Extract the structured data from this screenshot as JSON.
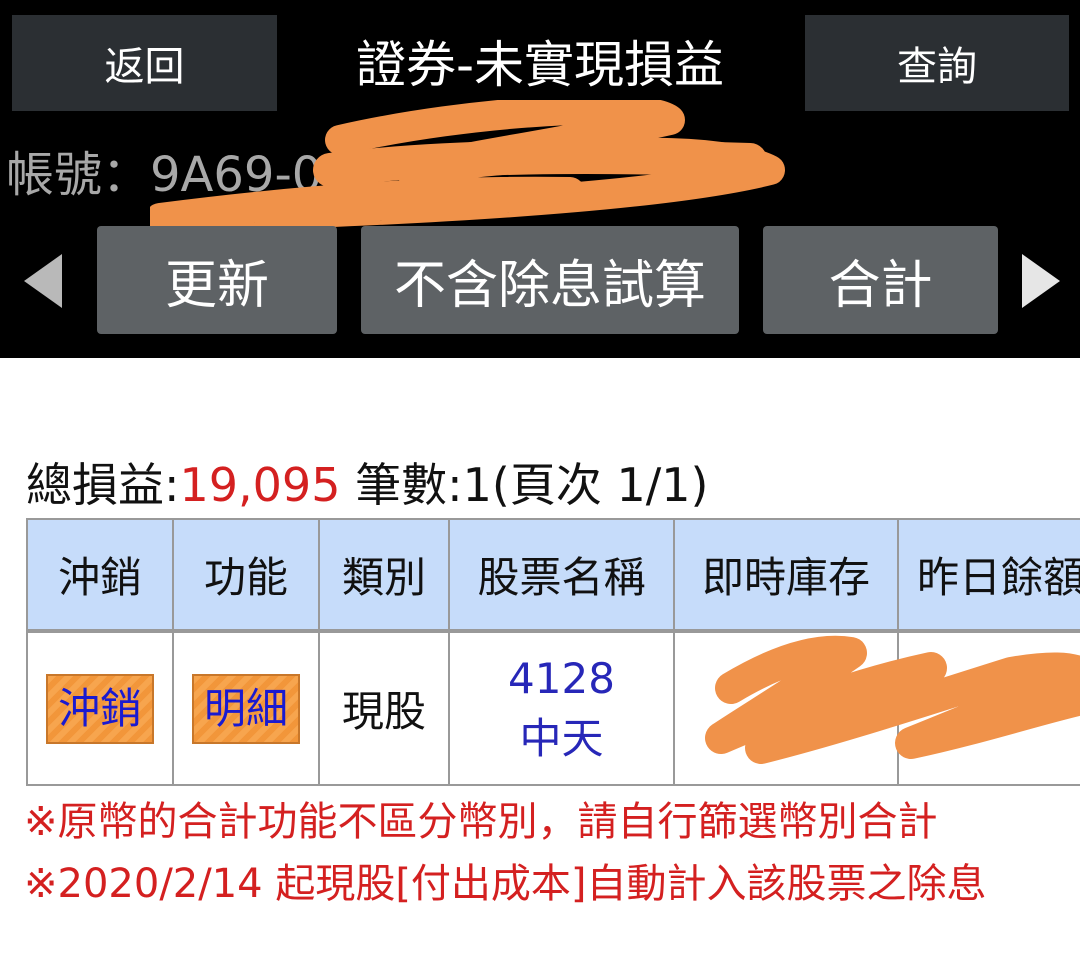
{
  "header": {
    "back_label": "返回",
    "title": "證券-未實現損益",
    "query_label": "查詢"
  },
  "account": {
    "label": "帳號：",
    "value": "9A69-0"
  },
  "toolbar": {
    "refresh_label": "更新",
    "no_dividend_label": "不含除息試算",
    "total_label": "合計"
  },
  "summary": {
    "total_pl_label": "總損益:",
    "total_pl_value": "19,095",
    "count_label": "筆數:",
    "count_value": "1",
    "page_text": "(頁次 1/1)"
  },
  "table": {
    "headers": [
      "沖銷",
      "功能",
      "類別",
      "股票名稱",
      "即時庫存",
      "昨日餘額"
    ],
    "rows": [
      {
        "offset_button": "沖銷",
        "detail_button": "明細",
        "category": "現股",
        "stock_code": "4128",
        "stock_name": "中天"
      }
    ]
  },
  "notes": {
    "line1": "※原幣的合計功能不區分幣別，請自行篩選幣別合計",
    "line2": "※2020/2/14 起現股[付出成本]自動計入該股票之除息"
  },
  "colors": {
    "header_bg": "#000000",
    "button_bg": "#5e6265",
    "table_header_bg": "#c6dcfa",
    "accent_red": "#d42020",
    "stock_blue": "#2727b8",
    "redaction": "#f0924a"
  }
}
